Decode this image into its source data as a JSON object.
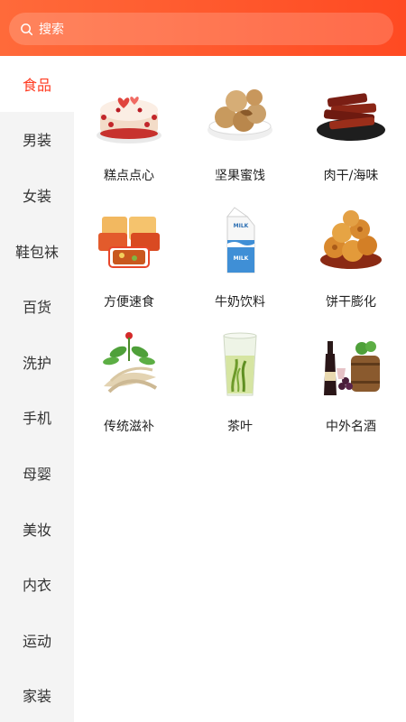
{
  "search": {
    "placeholder": "搜索",
    "icon": "search-icon"
  },
  "sidebar": {
    "items": [
      {
        "label": "食品",
        "active": true
      },
      {
        "label": "男装"
      },
      {
        "label": "女装"
      },
      {
        "label": "鞋包袜"
      },
      {
        "label": "百货"
      },
      {
        "label": "洗护"
      },
      {
        "label": "手机"
      },
      {
        "label": "母婴"
      },
      {
        "label": "美妆"
      },
      {
        "label": "内衣"
      },
      {
        "label": "运动"
      },
      {
        "label": "家装"
      }
    ]
  },
  "categories": [
    {
      "label": "糕点点心",
      "icon": "cake-icon"
    },
    {
      "label": "坚果蜜饯",
      "icon": "nuts-icon"
    },
    {
      "label": "肉干/海味",
      "icon": "jerky-icon"
    },
    {
      "label": "方便速食",
      "icon": "instant-food-icon"
    },
    {
      "label": "牛奶饮料",
      "icon": "milk-carton-icon"
    },
    {
      "label": "饼干膨化",
      "icon": "biscuits-icon"
    },
    {
      "label": "传统滋补",
      "icon": "ginseng-icon"
    },
    {
      "label": "茶叶",
      "icon": "tea-glass-icon"
    },
    {
      "label": "中外名酒",
      "icon": "wine-icon"
    }
  ],
  "colors": {
    "accent": "#ff5a2e",
    "active_text": "#ff3a20",
    "sidebar_bg": "#f4f4f4"
  },
  "milk_text": {
    "top": "MILK",
    "bottom": "MILK"
  }
}
